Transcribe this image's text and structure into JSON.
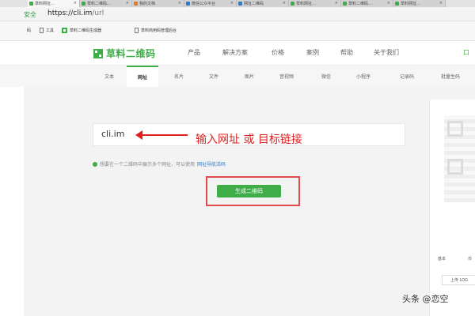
{
  "browser": {
    "tabs": [
      {
        "label": "草料网址…",
        "active": true
      },
      {
        "label": "草料二维码…",
        "active": false
      },
      {
        "label": "我的文档",
        "active": false
      },
      {
        "label": "微信公众平台",
        "active": false
      },
      {
        "label": "网址二维码",
        "active": false
      },
      {
        "label": "草料网址…",
        "active": false
      },
      {
        "label": "草料二维码…",
        "active": false
      },
      {
        "label": "草料网址…",
        "active": false
      }
    ],
    "security_label": "安全",
    "url_host": "https://cli.im",
    "url_path": "/url",
    "bookmarks": {
      "apps": "码",
      "tools": "工具",
      "qr_generator": "草料二维码生成器",
      "qr_manager": "草料商用码管理后台"
    }
  },
  "site": {
    "logo": "草料二维码",
    "nav": [
      "产品",
      "解决方案",
      "价格",
      "案例",
      "帮助",
      "关于我们"
    ],
    "header_right": "口"
  },
  "type_tabs": [
    "文本",
    "网址",
    "名片",
    "文件",
    "图片",
    "音视频",
    "微信",
    "小程序",
    "记录码",
    "批量生码"
  ],
  "main": {
    "input_value": "cli.im",
    "annotation": "输入网址 或 目标链接",
    "hint_text": "想要在一个二维码中展示多个网址，可以使用",
    "hint_link": "网址导航活码",
    "generate_button": "生成二维码",
    "panel_left": "基本",
    "panel_right": "币",
    "upload_button": "上传 LOG"
  },
  "watermark": "头条 @恋空",
  "colors": {
    "brand_green": "#3fae49",
    "annotation_red": "#e02020",
    "link_blue": "#2b7bd6"
  }
}
